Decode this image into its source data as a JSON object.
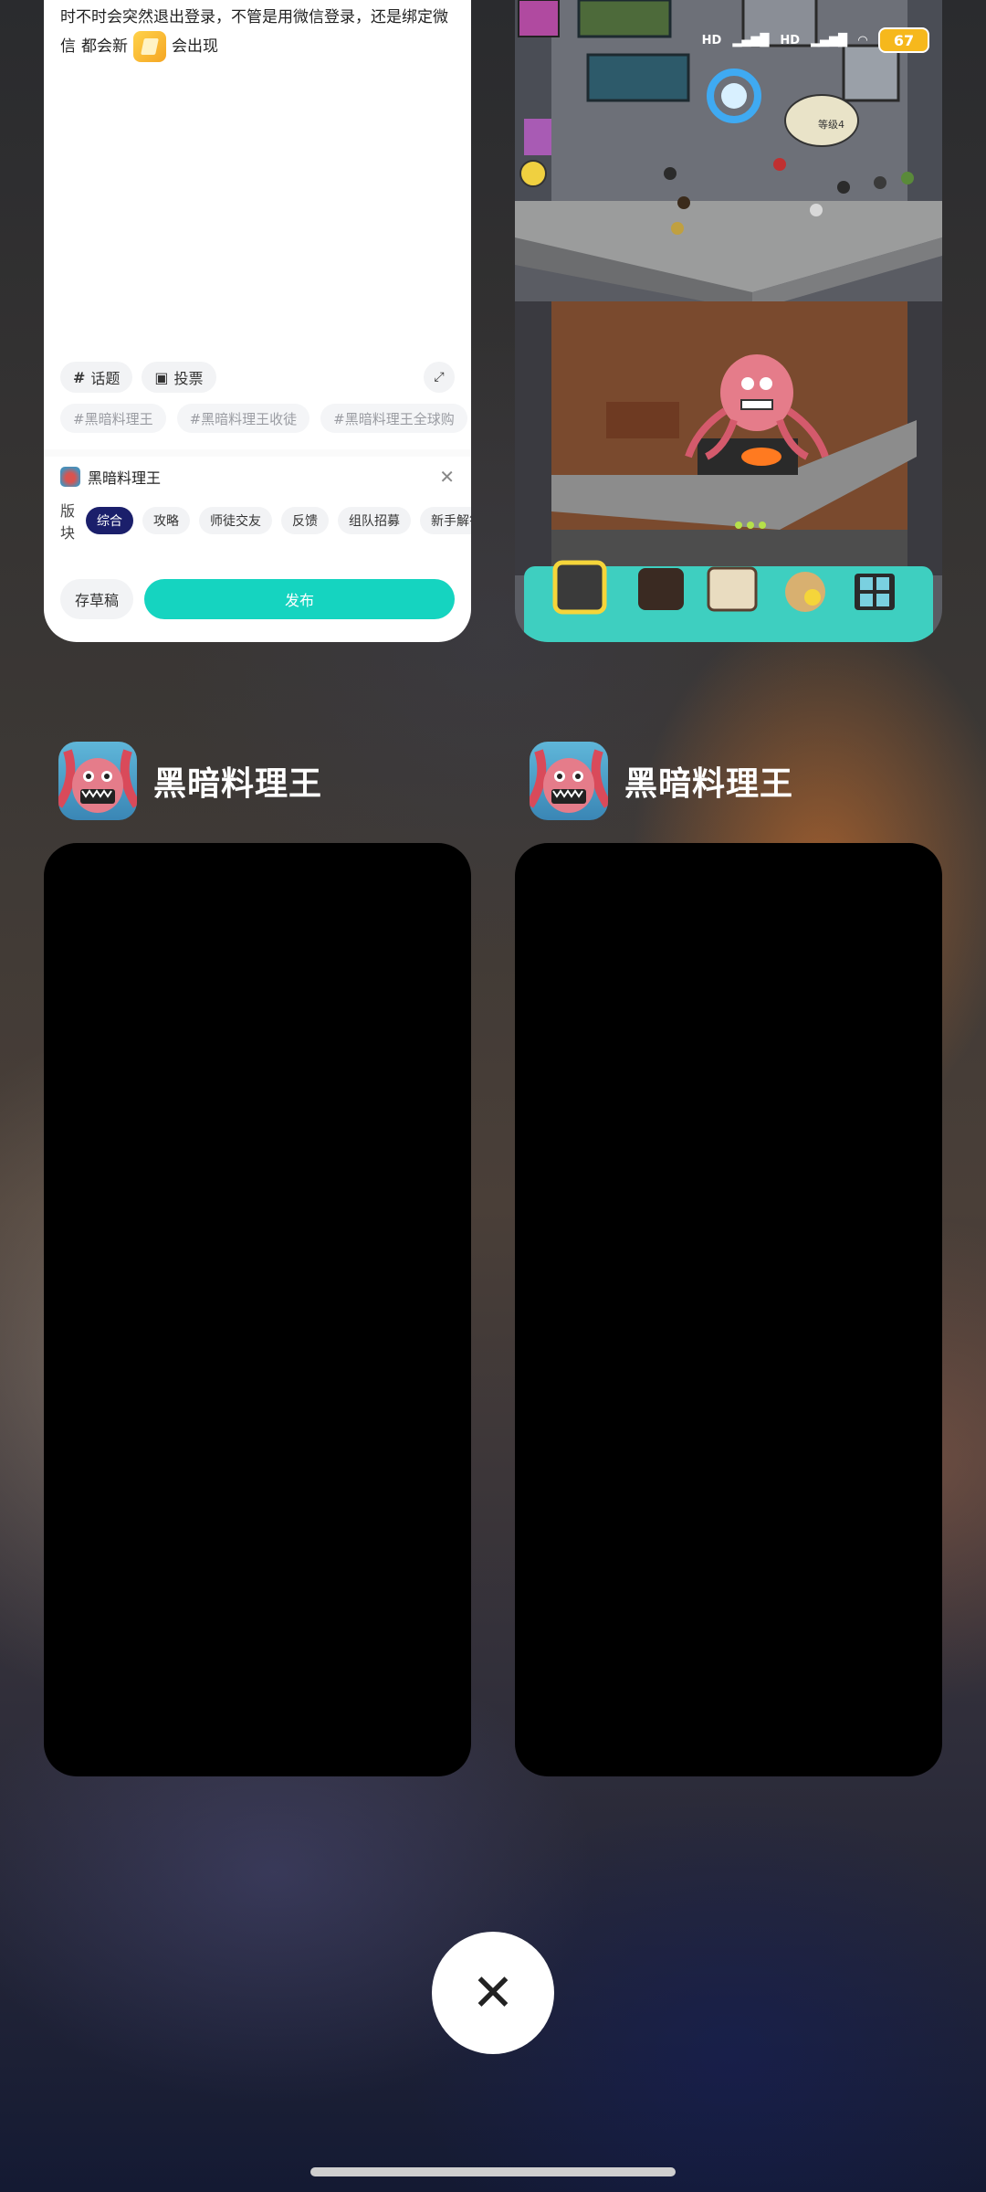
{
  "composer": {
    "post_line1": "时不时会突然退出登录，不管是用微信登录，还是绑定微",
    "post_line2_a": "信",
    "post_line2_b": "都会新",
    "post_line2_c": "会出现",
    "tool_topic": "话题",
    "tool_vote": "投票",
    "topics": [
      "#黑暗料理王",
      "#黑暗料理王收徒",
      "#黑暗料理王全球购"
    ],
    "game_name": "黑暗料理王",
    "section_label": "版块",
    "sections": [
      "综合",
      "攻略",
      "师徒交友",
      "反馈",
      "组队招募",
      "新手解答"
    ],
    "active_section": "综合",
    "draft_button": "存草稿",
    "publish_button": "发布"
  },
  "game_screen": {
    "signal_labels": [
      "HD",
      "HD"
    ],
    "battery": "67",
    "level_badge": "等级4"
  },
  "recent_apps": [
    {
      "title": "黑暗料理王"
    },
    {
      "title": "黑暗料理王"
    }
  ],
  "colors": {
    "publish": "#15d4c0",
    "active_chip": "#1b1f6b",
    "battery": "#f6b81c"
  },
  "icons": {
    "close_all": "close-icon",
    "topic": "hash-icon",
    "vote": "poll-icon"
  }
}
